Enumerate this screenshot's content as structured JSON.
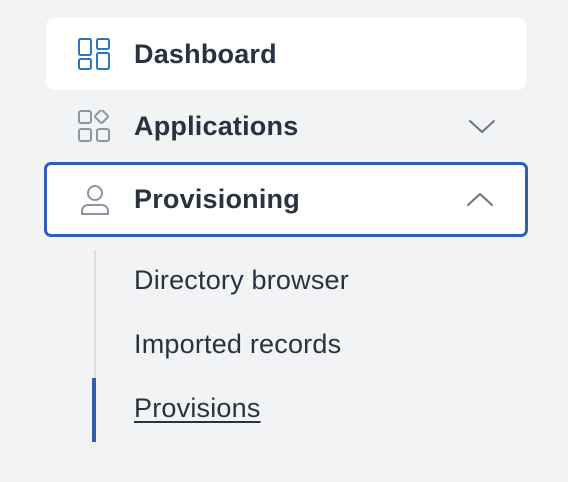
{
  "nav": {
    "items": [
      {
        "label": "Dashboard",
        "icon": "dashboard-grid-icon",
        "state": "selected"
      },
      {
        "label": "Applications",
        "icon": "apps-grid-icon",
        "state": "collapsed",
        "chevron": "chevron-down-icon"
      },
      {
        "label": "Provisioning",
        "icon": "user-icon",
        "state": "expanded-focused",
        "chevron": "chevron-up-icon"
      }
    ],
    "submenu": [
      {
        "label": "Directory browser"
      },
      {
        "label": "Imported records"
      },
      {
        "label": "Provisions",
        "active": true
      }
    ]
  },
  "colors": {
    "background": "#f2f3f5",
    "accent": "#2f5fb3",
    "text": "#2a3241",
    "icon_muted": "#8d95a3",
    "icon_accent": "#2f74c0"
  }
}
